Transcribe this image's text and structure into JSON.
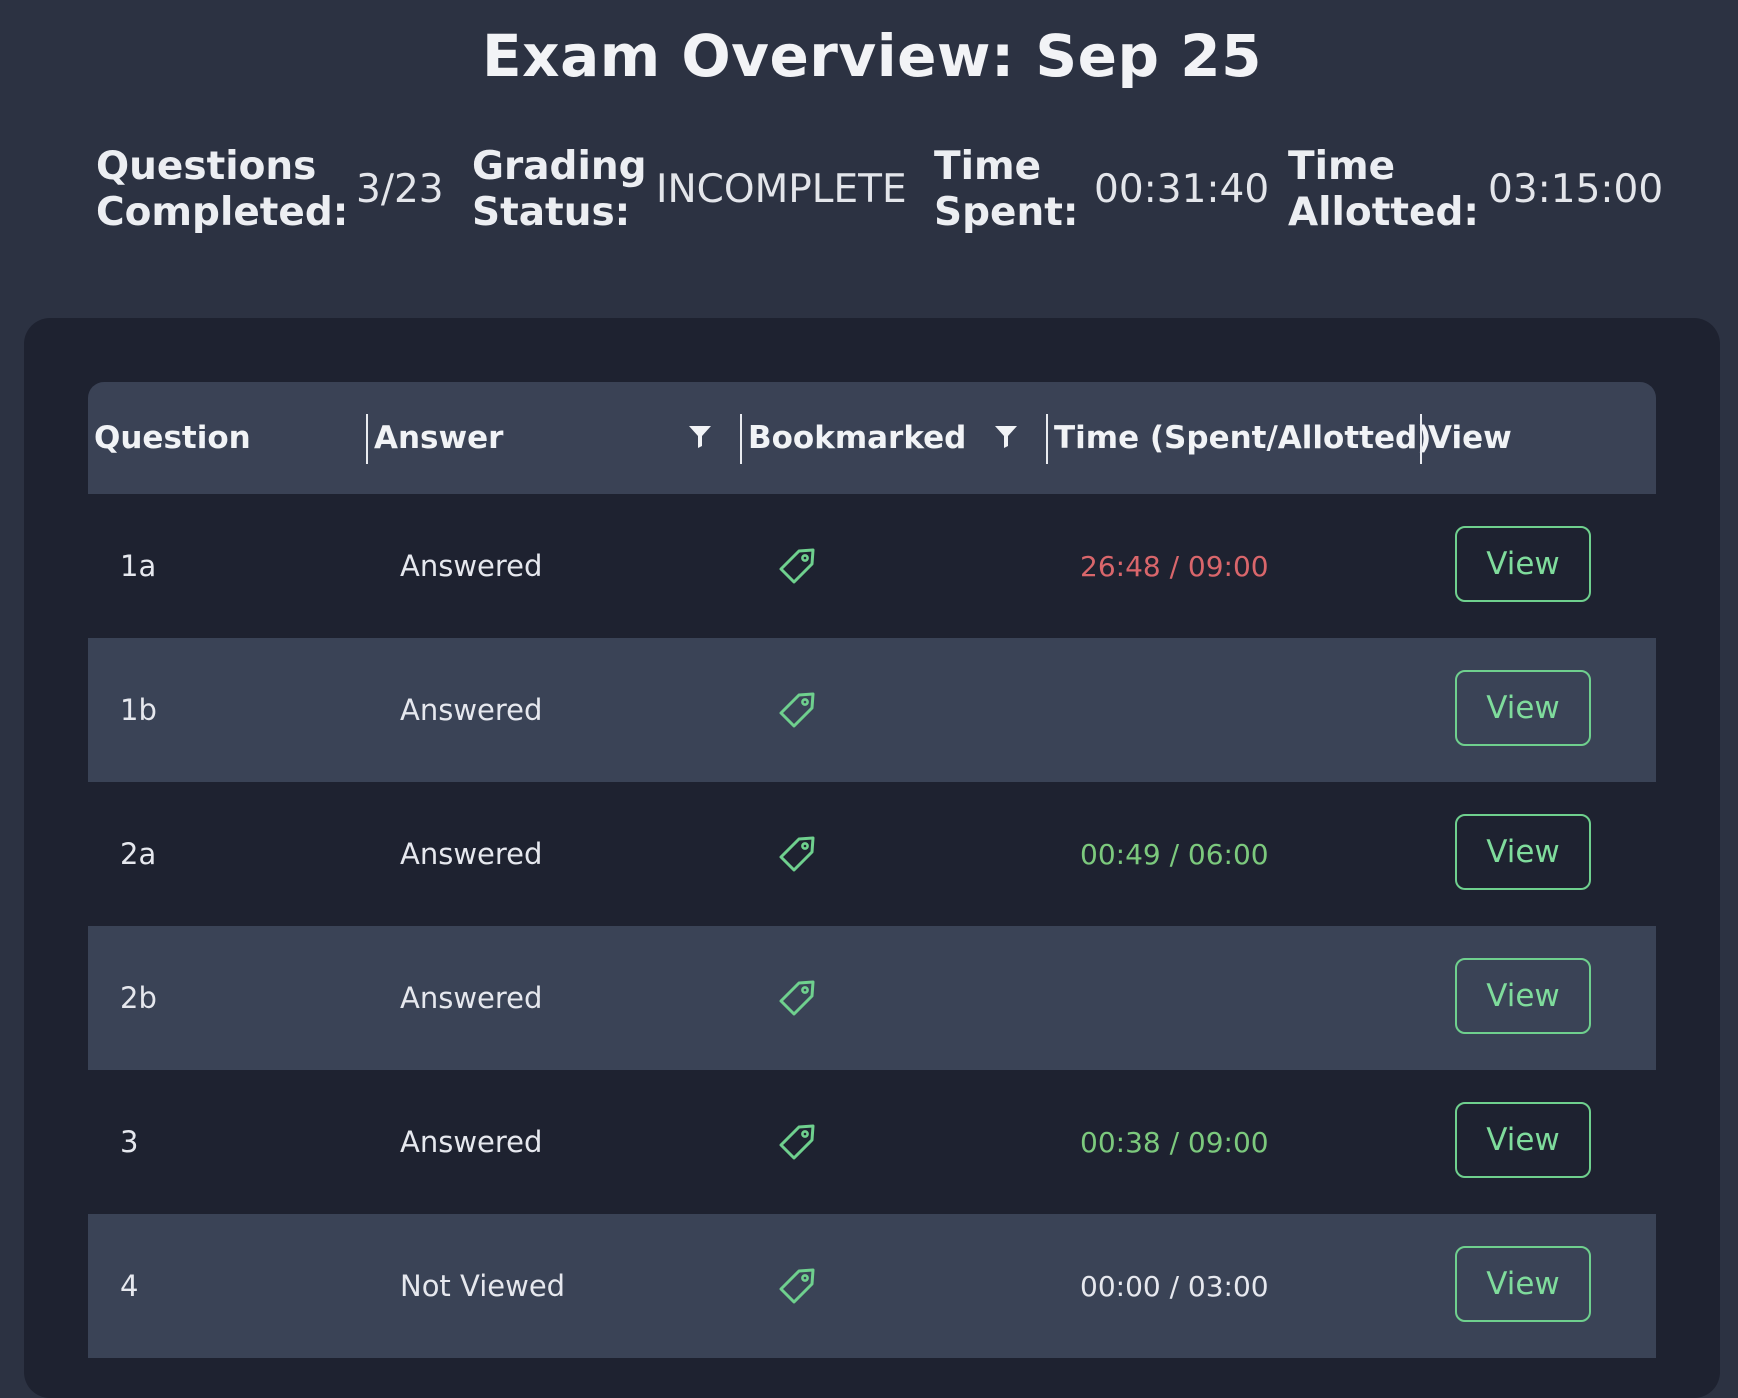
{
  "page": {
    "title": "Exam Overview: Sep 25"
  },
  "stats": {
    "questions_completed": {
      "label": "Questions\nCompleted:",
      "value": "3/23"
    },
    "grading_status": {
      "label": "Grading\nStatus:",
      "value": "INCOMPLETE"
    },
    "time_spent": {
      "label": "Time\nSpent:",
      "value": "00:31:40"
    },
    "time_allotted": {
      "label": "Time\nAllotted:",
      "value": "03:15:00"
    }
  },
  "table": {
    "columns": {
      "question": "Question",
      "answer": "Answer",
      "bookmarked": "Bookmarked",
      "time": "Time (Spent/Allotted)",
      "view": "View"
    },
    "rows": [
      {
        "question": "1a",
        "answer": "Answered",
        "time": "26:48 / 09:00",
        "time_status": "over",
        "view_label": "View"
      },
      {
        "question": "1b",
        "answer": "Answered",
        "time": "",
        "time_status": "none",
        "view_label": "View"
      },
      {
        "question": "2a",
        "answer": "Answered",
        "time": "00:49 / 06:00",
        "time_status": "under",
        "view_label": "View"
      },
      {
        "question": "2b",
        "answer": "Answered",
        "time": "",
        "time_status": "none",
        "view_label": "View"
      },
      {
        "question": "3",
        "answer": "Answered",
        "time": "00:38 / 09:00",
        "time_status": "under",
        "view_label": "View"
      },
      {
        "question": "4",
        "answer": "Not Viewed",
        "time": "00:00 / 03:00",
        "time_status": "neutral",
        "view_label": "View"
      }
    ]
  },
  "icons": {
    "filter": "filter-icon",
    "bookmark": "tag-icon"
  },
  "colors": {
    "background": "#2c3242",
    "panel": "#1e2230",
    "header_row": "#3a4255",
    "accent_green": "#6fd08e",
    "time_over": "#d9666b",
    "time_under": "#7cc97d",
    "time_neutral": "#e6e8ee"
  }
}
